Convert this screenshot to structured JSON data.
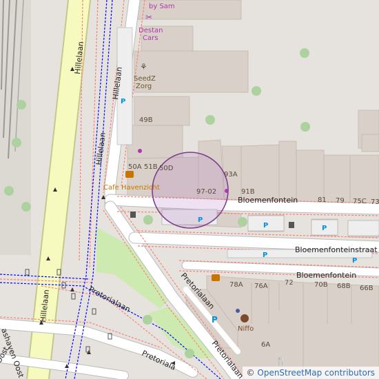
{
  "map": {
    "streets": {
      "hillelaan_main": "Hillelaan",
      "hillelaan_side": "Hillelaan",
      "hillelaan_top": "Hillelaan",
      "bloemenfontein_north": "Bloemenfontein",
      "bloemenfonteinstraat": "Bloemenfonteinstraat",
      "bloemenfontein_south": "Bloemenfontein",
      "pretorialaan_a": "Pretorialaan",
      "pretorialaan_b": "Pretorialaan",
      "pretorialaan_c": "Pretorialaan",
      "pretorialaan_d": "Pretorialaan",
      "pretorialaan_e": "Pretoriala",
      "oost_a": "ashaven Oost",
      "oost_b": "Oost"
    },
    "pois": {
      "sam": "by Sam",
      "destan": "Destan",
      "cars": "Cars",
      "seedz": "SeedZ",
      "zorg": "Zorg",
      "cafe": "Cafe Havenzicht",
      "niffo": "Niffo"
    },
    "house_numbers": {
      "h49b": "49B",
      "h50a": "50A",
      "h51b": "51B",
      "h50d": "50D",
      "h93a": "93A",
      "h9702": "97-02",
      "h91b": "91B",
      "h81": "81",
      "h79": "79",
      "h75c": "75C",
      "h73": "73",
      "h78a": "78A",
      "h76a": "76A",
      "h72": "72",
      "h70b": "70B",
      "h68b": "68B",
      "h66b": "66B",
      "h6a": "6A"
    },
    "parking_symbol": "P",
    "colors": {
      "background": "#e6e3df",
      "building": "#d9d0c9",
      "road": "#ffffff",
      "primary_road": "#f7fabf",
      "primary_casing": "#c6c88a",
      "tree": "#aed1a0",
      "footway": "#fa8072",
      "cycleway": "#0000ff",
      "marker_circle": "#7b3f8c",
      "parking": "#0092da",
      "poi_food": "#c77400",
      "poi_shop": "#ac39ac"
    },
    "icons": [
      "car-shop-icon",
      "pharmacy-icon",
      "cafe-icon",
      "waste-basket-icon",
      "parking-icon",
      "bicycle-parking-icon",
      "craft-shop-icon",
      "restaurant-icon",
      "tree-icon"
    ]
  },
  "attribution": {
    "copyright": "© ",
    "link_text": "OpenStreetMap contributors"
  }
}
